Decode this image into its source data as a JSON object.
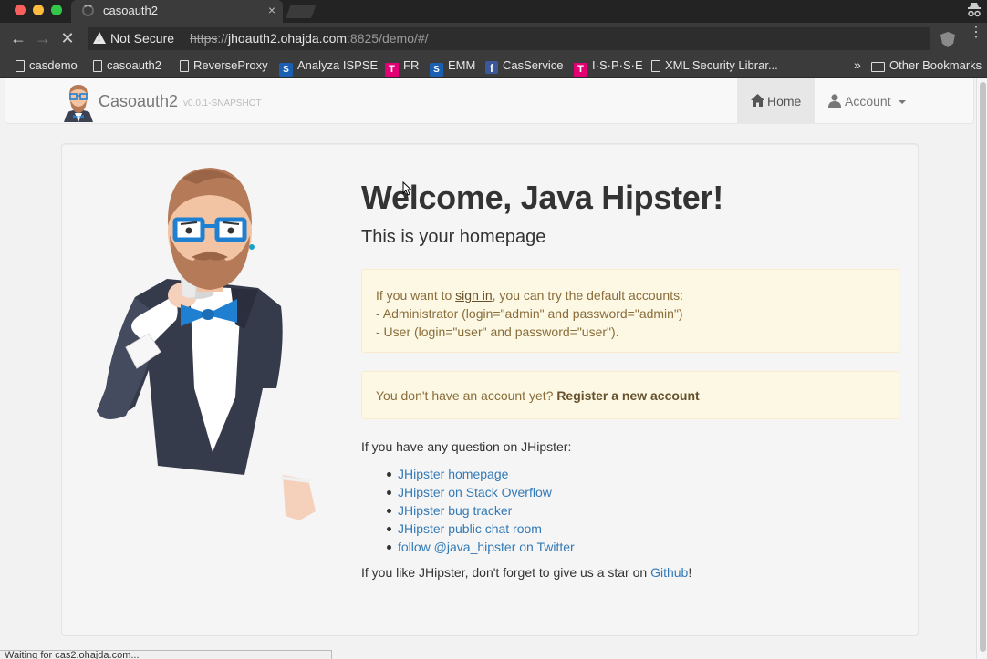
{
  "browser": {
    "tab_title": "casoauth2",
    "tab_close": "×",
    "security_label": "Not Secure",
    "url_scheme": "https",
    "url_sep": "://",
    "url_host": "jhoauth2.ohajda.com",
    "url_rest": ":8825/demo/#/",
    "star_glyph": "☆",
    "back_glyph": "←",
    "forward_glyph": "→",
    "stop_glyph": "✕",
    "menu_glyph": "⋮",
    "bookmarks": [
      {
        "label": "casdemo",
        "icon": "page-icon"
      },
      {
        "label": "casoauth2",
        "icon": "page-icon"
      },
      {
        "label": "ReverseProxy",
        "icon": "page-icon"
      },
      {
        "label": "Analyza ISPSE",
        "icon": "sharepoint-icon"
      },
      {
        "label": "FR",
        "icon": "telekom-icon"
      },
      {
        "label": "EMM",
        "icon": "sharepoint-icon"
      },
      {
        "label": "CasService",
        "icon": "facebook-icon"
      },
      {
        "label": "I·S·P·S·E",
        "icon": "telekom-icon"
      },
      {
        "label": "XML Security Librar...",
        "icon": "page-icon"
      }
    ],
    "bookmarks_more": "»",
    "other_bookmarks": "Other Bookmarks",
    "status_text": "Waiting for cas2.ohajda.com..."
  },
  "navbar": {
    "brand": "Casoauth2",
    "version": "v0.0.1-SNAPSHOT",
    "home_label": "Home",
    "account_label": "Account"
  },
  "main": {
    "title": "Welcome, Java Hipster!",
    "lead": "This is your homepage",
    "alert_prefix": "If you want to ",
    "alert_signin": "sign in",
    "alert_suffix": ", you can try the default accounts:",
    "alert_admin": "- Administrator (login=\"admin\" and password=\"admin\")",
    "alert_user": "- User (login=\"user\" and password=\"user\").",
    "register_prefix": "You don't have an account yet? ",
    "register_link": "Register a new account",
    "question": "If you have any question on JHipster:",
    "links": [
      "JHipster homepage",
      "JHipster on Stack Overflow",
      "JHipster bug tracker",
      "JHipster public chat room",
      "follow @java_hipster on Twitter"
    ],
    "star_prefix": "If you like JHipster, don't forget to give us a star on ",
    "star_link": "Github",
    "star_suffix": "!"
  },
  "colors": {
    "link": "#337ab7",
    "warning_bg": "#fcf8e3",
    "warning_text": "#8a6d3b"
  }
}
